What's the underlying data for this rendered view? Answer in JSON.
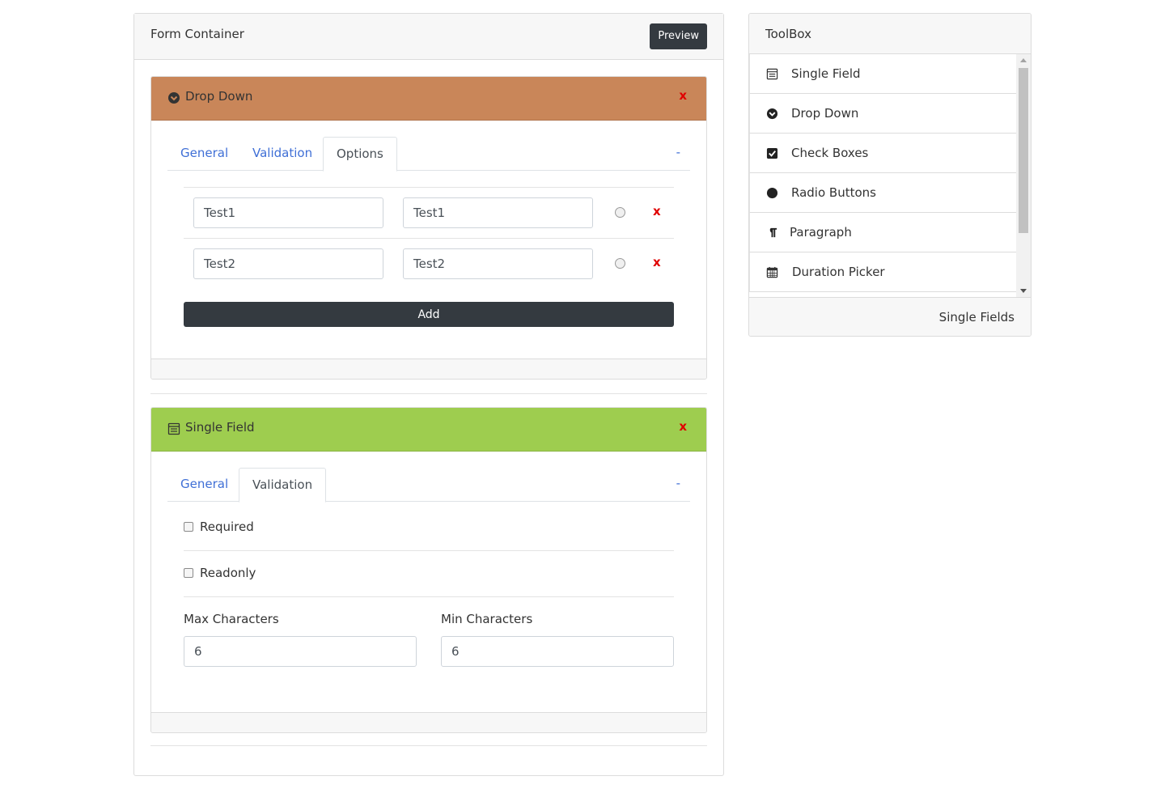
{
  "form_container": {
    "title": "Form Container",
    "preview_label": "Preview",
    "cards": [
      {
        "title": "Drop Down",
        "icon": "chevron-circle-down-icon",
        "header_color": "#c98659",
        "close_label": "x",
        "collapse_label": "-",
        "tabs": [
          "General",
          "Validation",
          "Options"
        ],
        "active_tab": "Options",
        "options": [
          {
            "label": "Test1",
            "value": "Test1",
            "remove_label": "x"
          },
          {
            "label": "Test2",
            "value": "Test2",
            "remove_label": "x"
          }
        ],
        "add_label": "Add"
      },
      {
        "title": "Single Field",
        "icon": "form-field-icon",
        "header_color": "#9ecd4f",
        "close_label": "x",
        "collapse_label": "-",
        "tabs": [
          "General",
          "Validation"
        ],
        "active_tab": "Validation",
        "validation": {
          "required_label": "Required",
          "readonly_label": "Readonly",
          "max_label": "Max Characters",
          "max_value": "6",
          "min_label": "Min Characters",
          "min_value": "6"
        }
      }
    ]
  },
  "toolbox": {
    "title": "ToolBox",
    "items": [
      {
        "label": "Single Field",
        "icon": "form-field-icon"
      },
      {
        "label": "Drop Down",
        "icon": "chevron-circle-down-icon"
      },
      {
        "label": "Check Boxes",
        "icon": "checkbox-checked-icon"
      },
      {
        "label": "Radio Buttons",
        "icon": "radio-filled-icon"
      },
      {
        "label": "Paragraph",
        "icon": "paragraph-icon"
      },
      {
        "label": "Duration Picker",
        "icon": "calendar-icon"
      }
    ],
    "footer_label": "Single Fields"
  }
}
